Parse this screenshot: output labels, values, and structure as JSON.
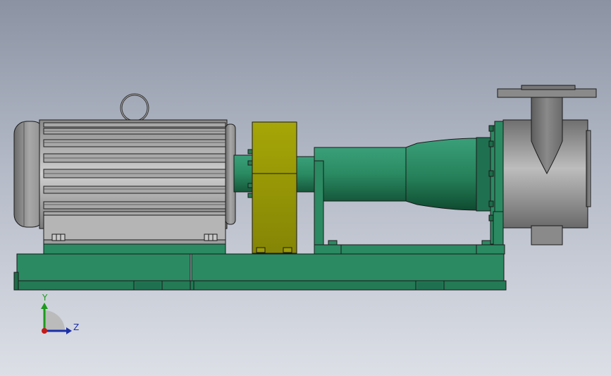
{
  "scene": {
    "assembly": "pump-motor-assembly",
    "components": [
      "motor",
      "lifting-eye",
      "coupling-guard",
      "bearing-bracket",
      "pump-casing",
      "discharge-flange",
      "base-frame"
    ],
    "colors": {
      "frame_green": "#2b8a62",
      "frame_dark": "#1d6b48",
      "frame_light": "#3a9a72",
      "coupling_yellow": "#9b9b06",
      "coupling_dark": "#7c7c05",
      "motor_gray": "#b8b8b8",
      "casing_gray": "#9a9a9a",
      "edge": "#1a1a1a"
    }
  },
  "triad": {
    "y_label": "Y",
    "z_label": "Z",
    "colors": {
      "y": "#1c9a1c",
      "z": "#1b2fa8",
      "x": "#c31a1a"
    }
  }
}
